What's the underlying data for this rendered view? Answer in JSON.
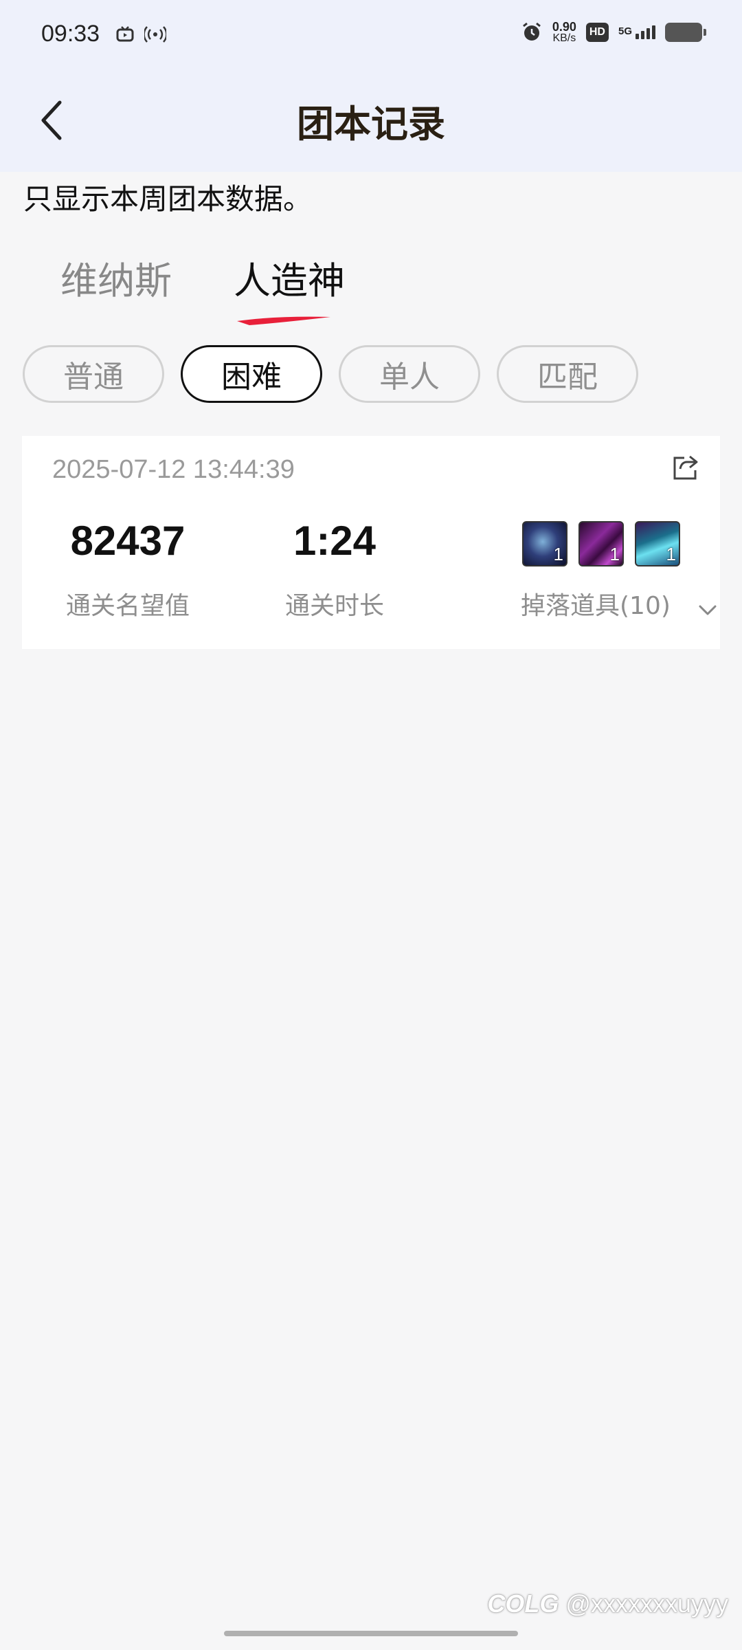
{
  "status_bar": {
    "time": "09:33",
    "left_icons": [
      "tv-icon",
      "hotspot-icon"
    ],
    "alarm_icon": "alarm-icon",
    "net_speed_value": "0.90",
    "net_speed_unit": "KB/s",
    "hd_badge": "HD",
    "network": "5G",
    "battery_icon": "battery-icon"
  },
  "header": {
    "title": "团本记录",
    "back_icon": "back-chevron-icon"
  },
  "notice": "只显示本周团本数据。",
  "boss_tabs": [
    {
      "label": "维纳斯",
      "active": false
    },
    {
      "label": "人造神",
      "active": true
    }
  ],
  "difficulty_chips": [
    {
      "label": "普通",
      "active": false
    },
    {
      "label": "困难",
      "active": true
    },
    {
      "label": "单人",
      "active": false
    },
    {
      "label": "匹配",
      "active": false
    }
  ],
  "record": {
    "timestamp": "2025-07-12 13:44:39",
    "fame_value": "82437",
    "fame_label": "通关名望值",
    "duration_value": "1:24",
    "duration_label": "通关时长",
    "drop_items": [
      {
        "icon": "dark-orb-item-icon",
        "count": "1",
        "color": "#2f3f7a"
      },
      {
        "icon": "purple-shard-item-icon",
        "count": "1",
        "color": "#6a1a6e"
      },
      {
        "icon": "cyan-crystal-item-icon",
        "count": "1",
        "color": "#1b6f8c"
      }
    ],
    "drops_label": "掉落道具(10)"
  },
  "watermark": {
    "logo": "COLG",
    "handle": "@xxxxxxxuyyy"
  },
  "colors": {
    "header_bg": "#eef1fb",
    "page_bg": "#f6f6f7",
    "accent_red": "#e8203a",
    "title_text": "#2a2013"
  }
}
